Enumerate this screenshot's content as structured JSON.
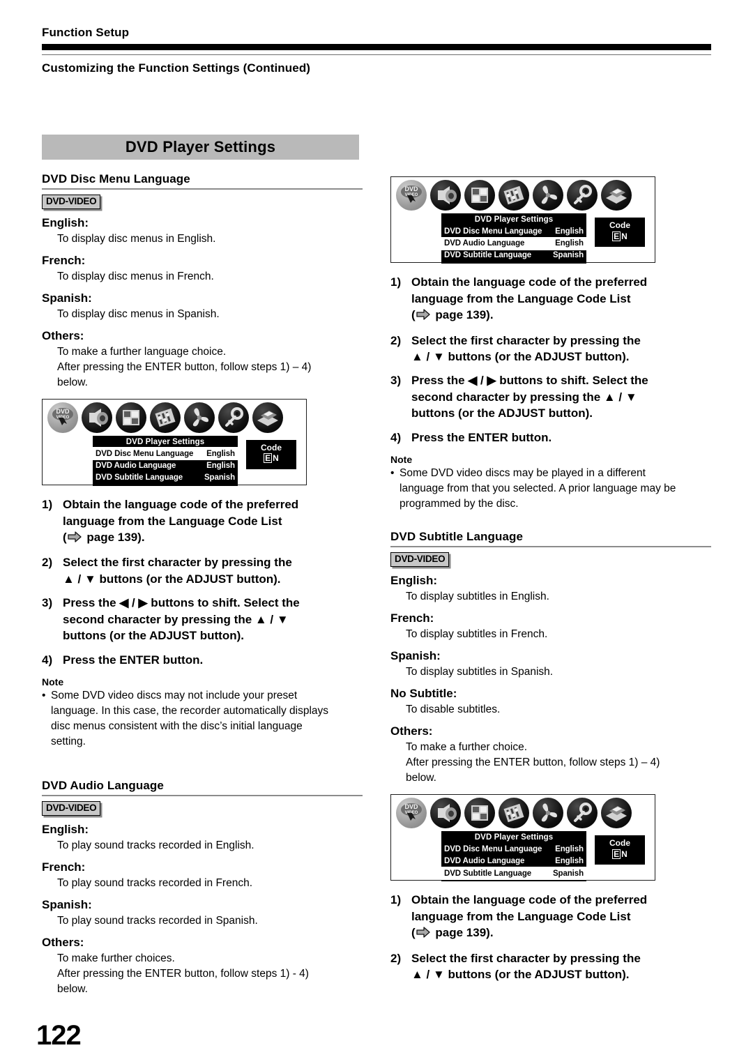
{
  "header": {
    "kicker": "Function Setup",
    "subtitle": "Customizing the Function Settings (Continued)"
  },
  "banner": {
    "title": "DVD Player Settings"
  },
  "page_number": "122",
  "badge_label": "DVD-VIDEO",
  "note_label": "Note",
  "note_bullet": "•",
  "osd": {
    "title": "DVD Player Settings",
    "code_label": "Code",
    "code_first": "E",
    "code_second": "N",
    "rows": [
      {
        "label": "DVD Disc Menu Language",
        "value": "English"
      },
      {
        "label": "DVD Audio Language",
        "value": "English"
      },
      {
        "label": "DVD Subtitle Language",
        "value": "Spanish"
      }
    ],
    "icons": [
      "dvd-video-disc-icon",
      "speaker-icon",
      "display-grid-icon",
      "av-settings-icon",
      "function-fan-icon",
      "key-lock-icon",
      "disc-tray-icon"
    ]
  },
  "steps": {
    "s1_num": "1)",
    "s1_l1": "Obtain the language code of the preferred",
    "s1_l2": "language from the Language Code List",
    "s1_l3_pre": "(",
    "s1_l3_post": " page 139).",
    "s2_num": "2)",
    "s2_l1": "Select the first character by pressing the",
    "s2_l2": "▲ / ▼ buttons (or the ADJUST button).",
    "s3_num": "3)",
    "s3_l1": "Press the ◀ / ▶ buttons to shift. Select the",
    "s3_l2": "second character by pressing the ▲ / ▼",
    "s3_l3": "buttons (or the ADJUST button).",
    "s4_num": "4)",
    "s4_l1": "Press the ENTER button."
  },
  "sections": {
    "disc_menu": {
      "heading": "DVD Disc Menu Language",
      "options": [
        {
          "term": "English:",
          "desc_lines": [
            "To display disc menus in English."
          ]
        },
        {
          "term": "French:",
          "desc_lines": [
            "To display disc menus in French."
          ]
        },
        {
          "term": "Spanish:",
          "desc_lines": [
            "To display disc menus in Spanish."
          ]
        },
        {
          "term": "Others:",
          "desc_lines": [
            "To make a further language choice.",
            "After pressing the ENTER button, follow steps 1) – 4)",
            "below."
          ]
        }
      ],
      "note_lines": [
        "Some DVD video discs may not include your preset",
        "language. In this case, the recorder automatically displays",
        "disc menus consistent with the disc’s initial language",
        "setting."
      ]
    },
    "audio": {
      "heading": "DVD Audio Language",
      "options": [
        {
          "term": "English:",
          "desc_lines": [
            "To play sound tracks recorded in English."
          ]
        },
        {
          "term": "French:",
          "desc_lines": [
            "To play sound tracks recorded in French."
          ]
        },
        {
          "term": "Spanish:",
          "desc_lines": [
            "To play sound tracks recorded in Spanish."
          ]
        },
        {
          "term": "Others:",
          "desc_lines": [
            "To make further choices.",
            "After pressing the ENTER button, follow steps 1) - 4)",
            "below."
          ]
        }
      ],
      "note_lines": [
        "Some DVD video discs may be played in a different",
        "language from that you selected. A prior language may be",
        "programmed by the disc."
      ]
    },
    "subtitle": {
      "heading": "DVD Subtitle Language",
      "options": [
        {
          "term": "English:",
          "desc_lines": [
            "To display subtitles in English."
          ]
        },
        {
          "term": "French:",
          "desc_lines": [
            "To display subtitles in French."
          ]
        },
        {
          "term": "Spanish:",
          "desc_lines": [
            "To display subtitles in Spanish."
          ]
        },
        {
          "term": "No Subtitle:",
          "desc_lines": [
            "To disable subtitles."
          ]
        },
        {
          "term": "Others:",
          "desc_lines": [
            "To make a further choice.",
            "After pressing the ENTER button, follow steps 1) – 4)",
            "below."
          ]
        }
      ]
    }
  }
}
